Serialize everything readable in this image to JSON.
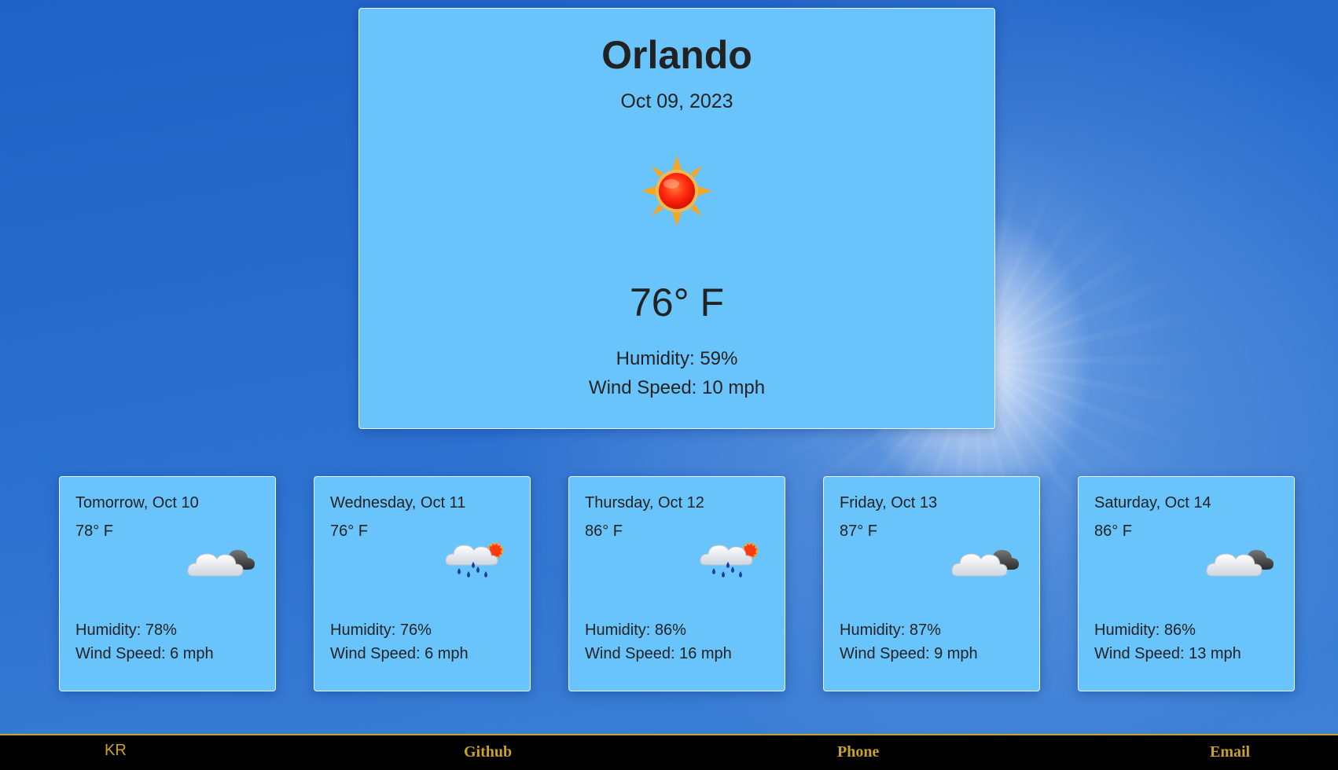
{
  "current": {
    "city": "Orlando",
    "date": "Oct 09, 2023",
    "icon": "sun-icon",
    "temperature": "76° F",
    "humidity": "Humidity: 59%",
    "wind": "Wind Speed: 10 mph"
  },
  "forecast": [
    {
      "day": "Tomorrow, Oct 10",
      "temp": "78° F",
      "icon": "partly-cloudy-icon",
      "humidity": "Humidity: 78%",
      "wind": "Wind Speed: 6 mph"
    },
    {
      "day": "Wednesday, Oct 11",
      "temp": "76° F",
      "icon": "rain-sun-icon",
      "humidity": "Humidity: 76%",
      "wind": "Wind Speed: 6 mph"
    },
    {
      "day": "Thursday, Oct 12",
      "temp": "86° F",
      "icon": "rain-sun-icon",
      "humidity": "Humidity: 86%",
      "wind": "Wind Speed: 16 mph"
    },
    {
      "day": "Friday, Oct 13",
      "temp": "87° F",
      "icon": "partly-cloudy-icon",
      "humidity": "Humidity: 87%",
      "wind": "Wind Speed: 9 mph"
    },
    {
      "day": "Saturday, Oct 14",
      "temp": "86° F",
      "icon": "partly-cloudy-icon",
      "humidity": "Humidity: 86%",
      "wind": "Wind Speed: 13 mph"
    }
  ],
  "footer": {
    "brand": "KR",
    "github": "Github",
    "phone": "Phone",
    "email": "Email"
  },
  "colors": {
    "card": "#6ac4fc",
    "footer_text": "#c9a227",
    "footer_bg": "#000000"
  }
}
